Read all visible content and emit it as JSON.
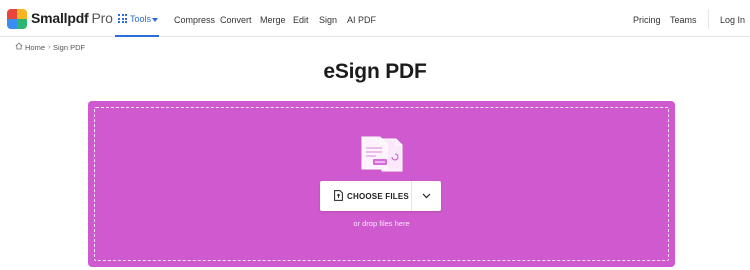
{
  "brand": {
    "name": "Smallpdf",
    "tier": "Pro"
  },
  "nav": {
    "tools_label": "Tools",
    "links": [
      "Compress",
      "Convert",
      "Merge",
      "Edit",
      "Sign",
      "AI PDF"
    ],
    "right_links": [
      "Pricing",
      "Teams"
    ],
    "login_label": "Log In"
  },
  "breadcrumb": {
    "home": "Home",
    "current": "Sign PDF",
    "separator": "›"
  },
  "page": {
    "title": "eSign PDF"
  },
  "dropzone": {
    "choose_label": "CHOOSE FILES",
    "hint": "or drop files here"
  },
  "colors": {
    "accent": "#2d6bd8",
    "dropzone": "#cf59ce",
    "logo": [
      "#e8463a",
      "#f5b423",
      "#3c8df0",
      "#2bb673"
    ]
  },
  "icons": {
    "logo": "smallpdf-logo",
    "tools": "grid-icon",
    "tools_caret": "caret-down-icon",
    "home": "home-icon",
    "documents": "pdf-documents-icon",
    "file": "file-upload-icon",
    "more": "chevron-down-icon"
  }
}
